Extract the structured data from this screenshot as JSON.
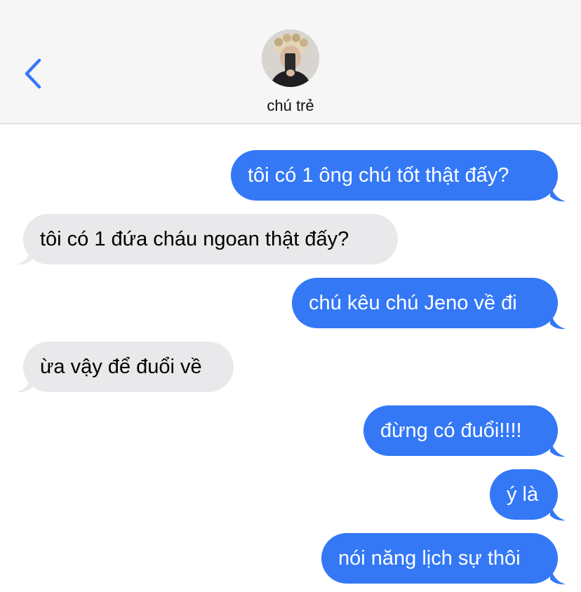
{
  "header": {
    "contact_name": "chú trẻ",
    "back_icon": "chevron-left-icon",
    "avatar": "contact-avatar"
  },
  "colors": {
    "outgoing_bubble": "#3478f6",
    "incoming_bubble": "#e9e9eb",
    "accent": "#3478f6",
    "header_bg": "#f6f6f6"
  },
  "messages": [
    {
      "direction": "outgoing",
      "text": "tôi có 1 ông chú tốt thật đấy?"
    },
    {
      "direction": "incoming",
      "text": "tôi có 1 đứa cháu ngoan thật đấy?"
    },
    {
      "direction": "outgoing",
      "text": "chú kêu chú Jeno về đi"
    },
    {
      "direction": "incoming",
      "text": "ừa vậy để đuổi về"
    },
    {
      "direction": "outgoing",
      "text": "đừng có đuổi!!!!"
    },
    {
      "direction": "outgoing",
      "text": "ý là"
    },
    {
      "direction": "outgoing",
      "text": "nói năng lịch sự thôi"
    }
  ]
}
